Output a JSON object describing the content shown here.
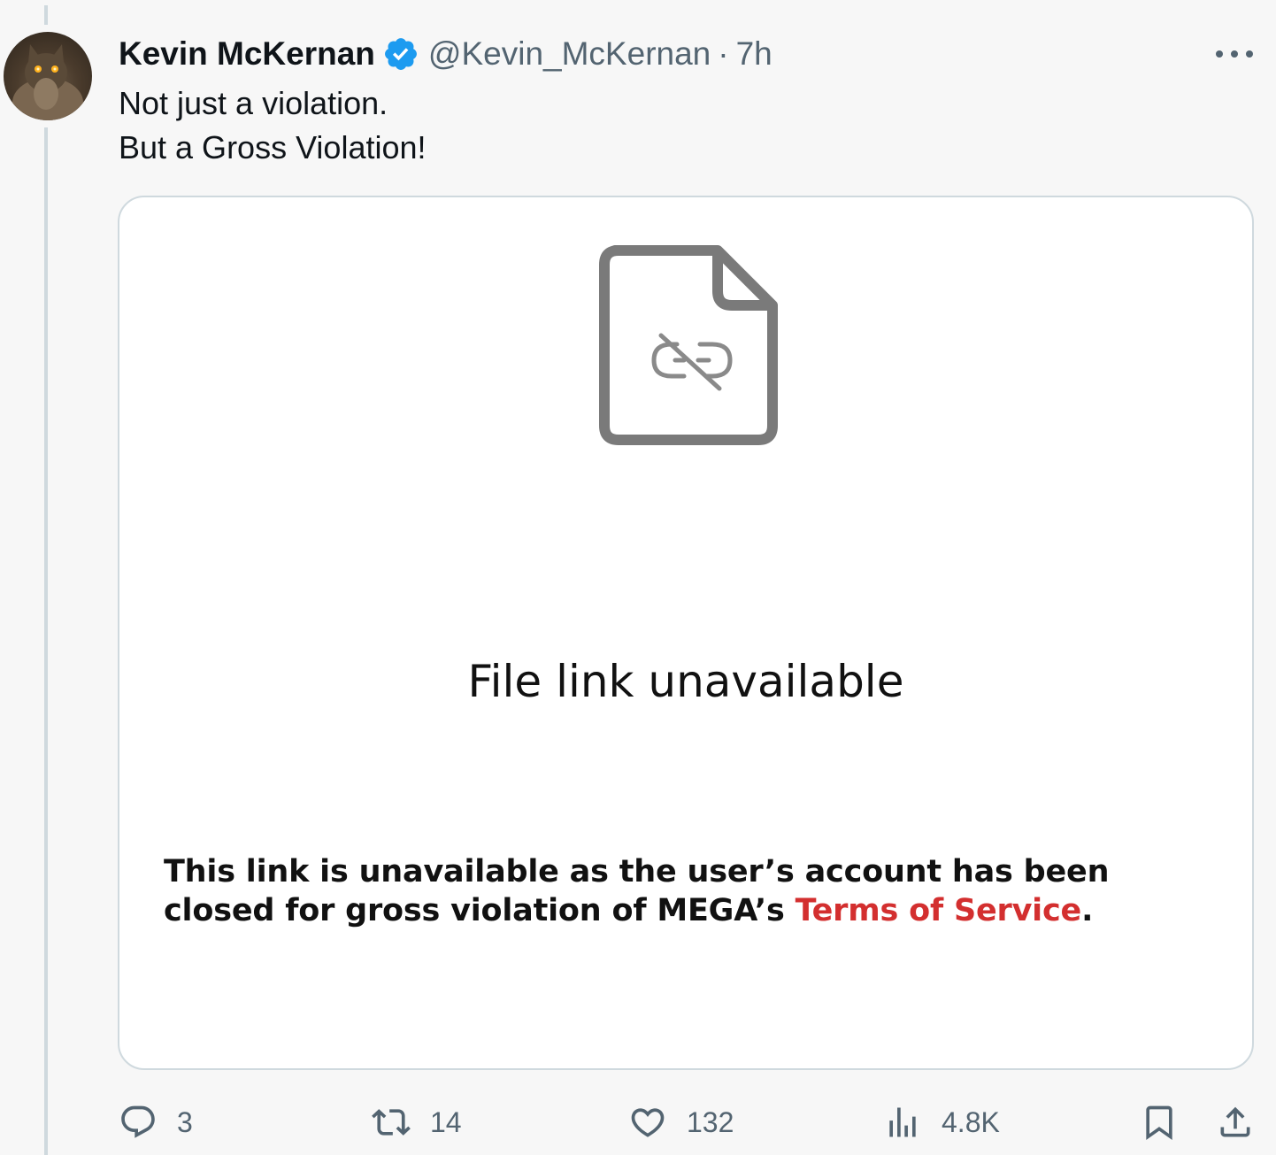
{
  "tweet": {
    "author": {
      "display_name": "Kevin McKernan",
      "handle": "@Kevin_McKernan",
      "verified": true
    },
    "separator": "·",
    "time": "7h",
    "text_lines": [
      "Not just a violation.",
      "But a Gross Violation!"
    ]
  },
  "card": {
    "icon": "broken-link-file-icon",
    "title": "File link unavailable",
    "message_prefix": "This link is unavailable as the user’s account has been closed for gross violation of MEGA’s ",
    "link_text": "Terms of Service",
    "message_suffix": ".",
    "link_color": "#d32f2f"
  },
  "actions": {
    "replies": "3",
    "retweets": "14",
    "likes": "132",
    "views": "4.8K"
  },
  "colors": {
    "verified_badge": "#1d9bf0",
    "secondary_text": "#536471",
    "thread_line": "#cfd9de"
  }
}
